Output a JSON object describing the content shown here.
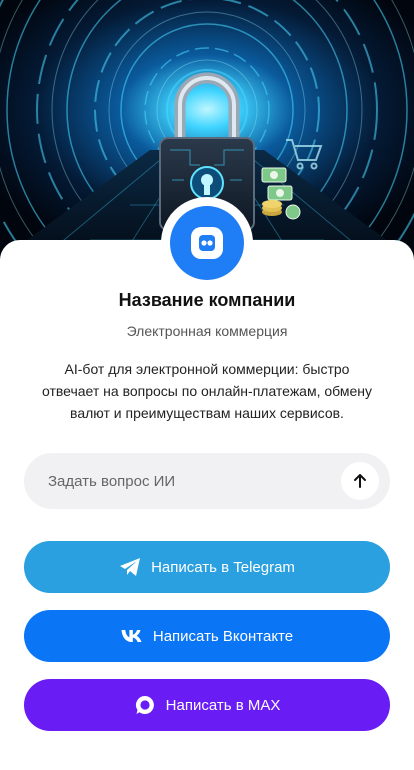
{
  "company": {
    "name": "Название компании",
    "category": "Электронная коммерция",
    "description": "AI-бот для электронной коммерции: быстро отвечает на вопросы по онлайн-платежам, обмену валют и преимуществам наших сервисов."
  },
  "ask": {
    "placeholder": "Задать вопрос ИИ",
    "send_icon": "arrow-up-icon"
  },
  "buttons": {
    "telegram": {
      "label": "Написать в Telegram",
      "icon": "telegram-icon",
      "color": "#2aa0e0"
    },
    "vk": {
      "label": "Написать Вконтакте",
      "icon": "vk-icon",
      "color": "#0a76f5"
    },
    "max": {
      "label": "Написать в MAX",
      "icon": "max-icon",
      "color": "#6a1cf5"
    }
  },
  "colors": {
    "avatar": "#1f7ef5",
    "input_bg": "#f1f1f3"
  }
}
